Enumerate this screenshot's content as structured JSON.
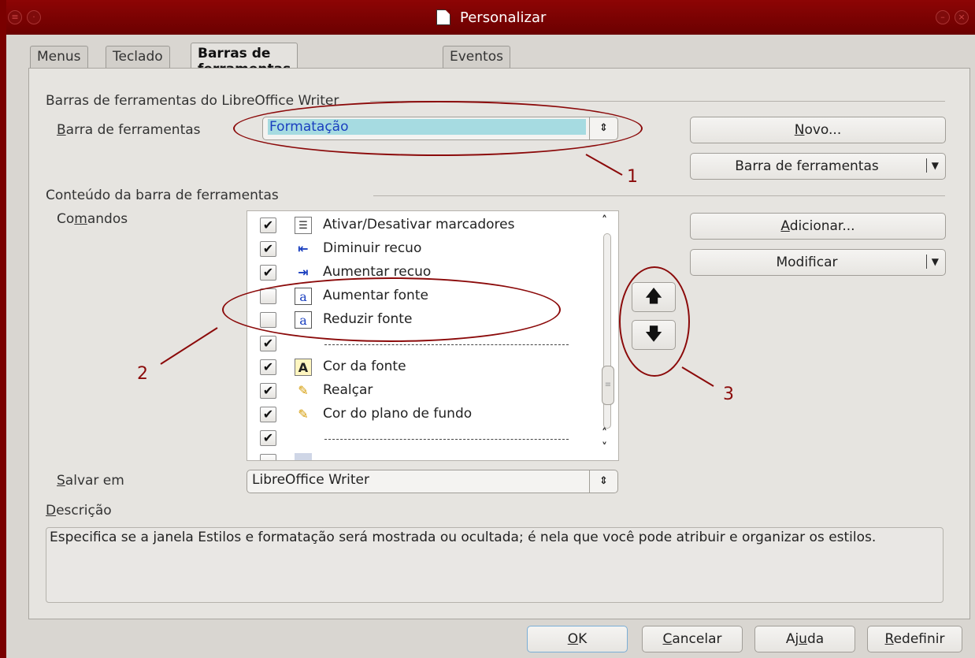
{
  "window": {
    "title": "Personalizar",
    "title_icon": "document-icon"
  },
  "tabs": [
    {
      "label": "Menus"
    },
    {
      "label": "Teclado"
    },
    {
      "label": "Barras de ferramentas",
      "active": true
    },
    {
      "label": "Eventos"
    }
  ],
  "toolbars_section": {
    "heading": "Barras de ferramentas do LibreOffice Writer",
    "toolbar_label_underlined": "B",
    "toolbar_label_rest": "arra de ferramentas",
    "toolbar_value": "Formatação"
  },
  "buttons": {
    "new_underlined": "N",
    "new_rest": "ovo...",
    "toolbar_menu": "Barra de ferramentas",
    "add_underlined": "A",
    "add_rest": "dicionar...",
    "modify": "Modificar",
    "ok_underlined": "O",
    "ok_rest": "K",
    "cancel_underlined": "C",
    "cancel_rest": "ancelar",
    "help_pre": "Aj",
    "help_underlined": "u",
    "help_post": "da",
    "reset_underlined": "R",
    "reset_rest": "edefinir"
  },
  "content_section": {
    "heading": "Conteúdo da barra de ferramentas",
    "commands_pre": "Co",
    "commands_underlined": "m",
    "commands_post": "andos"
  },
  "commands": [
    {
      "label": "Ativar/Desativar marcadores",
      "checked": true,
      "icon": "bullets-icon",
      "glyph": "☰"
    },
    {
      "label": "Diminuir recuo",
      "checked": true,
      "icon": "decrease-indent-icon",
      "glyph": "⇤"
    },
    {
      "label": "Aumentar recuo",
      "checked": true,
      "icon": "increase-indent-icon",
      "glyph": "⇥"
    },
    {
      "label": "Aumentar fonte",
      "checked": false,
      "icon": "grow-font-icon",
      "glyph": "a"
    },
    {
      "label": "Reduzir fonte",
      "checked": false,
      "icon": "shrink-font-icon",
      "glyph": "a"
    },
    {
      "label": "",
      "checked": true,
      "separator": true
    },
    {
      "label": "Cor da fonte",
      "checked": true,
      "icon": "font-color-icon",
      "glyph": "A"
    },
    {
      "label": "Realçar",
      "checked": true,
      "icon": "highlight-icon",
      "glyph": "✎"
    },
    {
      "label": "Cor do plano de fundo",
      "checked": true,
      "icon": "background-color-icon",
      "glyph": "✎"
    },
    {
      "label": "",
      "checked": true,
      "separator": true
    },
    {
      "label": "",
      "checked": false,
      "icon": "partial-row-icon",
      "glyph": ""
    }
  ],
  "save_in": {
    "label_underlined": "S",
    "label_rest": "alvar em",
    "value": "LibreOffice Writer"
  },
  "description": {
    "label_underlined": "D",
    "label_rest": "escrição",
    "text": "Especifica se a janela Estilos e formatação será mostrada ou ocultada; é nela que você pode atribuir e organizar os estilos."
  },
  "annotations": {
    "one": "1",
    "two": "2",
    "three": "3"
  },
  "colors": {
    "titlebar": "#7a0000",
    "annotation": "#8b0a0a",
    "selection": "#a6dbe1"
  }
}
